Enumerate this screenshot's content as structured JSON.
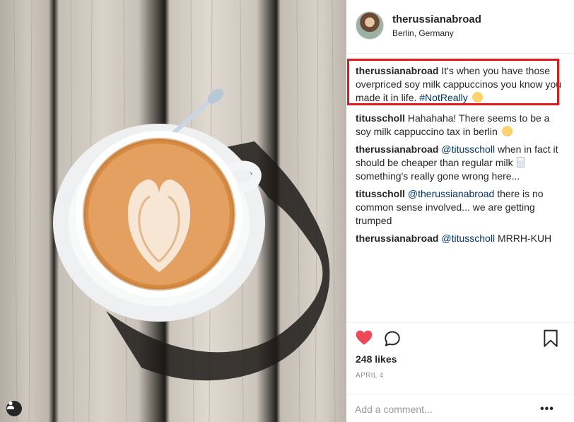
{
  "post": {
    "username": "therussianabroad",
    "location": "Berlin, Germany",
    "avatar_icon": "profile-avatar",
    "tag_icon": "user-tag-icon"
  },
  "comments": [
    {
      "user": "therussianabroad",
      "text": "It's when you have those overpriced soy milk cappuccinos you know you made it in life. ",
      "hashtag": "#NotReally",
      "emoji": "thinking-face-emoji"
    },
    {
      "user": "titusscholl",
      "text": "Hahahaha! There seems to be a soy milk cappuccino tax in berlin",
      "emoji": "flushed-face-emoji"
    },
    {
      "user": "therussianabroad",
      "mention": "@titusscholl",
      "text": " when in fact it should be cheaper than regular milk ",
      "emoji": "milk-glass-emoji",
      "text2": " something's really gone wrong here..."
    },
    {
      "user": "titusscholl",
      "mention": "@therussianabroad",
      "text": " there is no common sense involved... we are getting trumped"
    },
    {
      "user": "therussianabroad",
      "mention": "@titusscholl",
      "text": " MRRH-KUH"
    }
  ],
  "actions": {
    "like_icon": "heart-icon",
    "comment_icon": "comment-icon",
    "save_icon": "bookmark-icon",
    "likes": "248 likes",
    "date": "APRIL 4",
    "add_comment_placeholder": "Add a comment...",
    "more_label": "•••"
  },
  "colors": {
    "heart": "#ed4956",
    "link": "#003569",
    "highlight_border": "#e3191c",
    "muted": "#8e8e8e"
  }
}
